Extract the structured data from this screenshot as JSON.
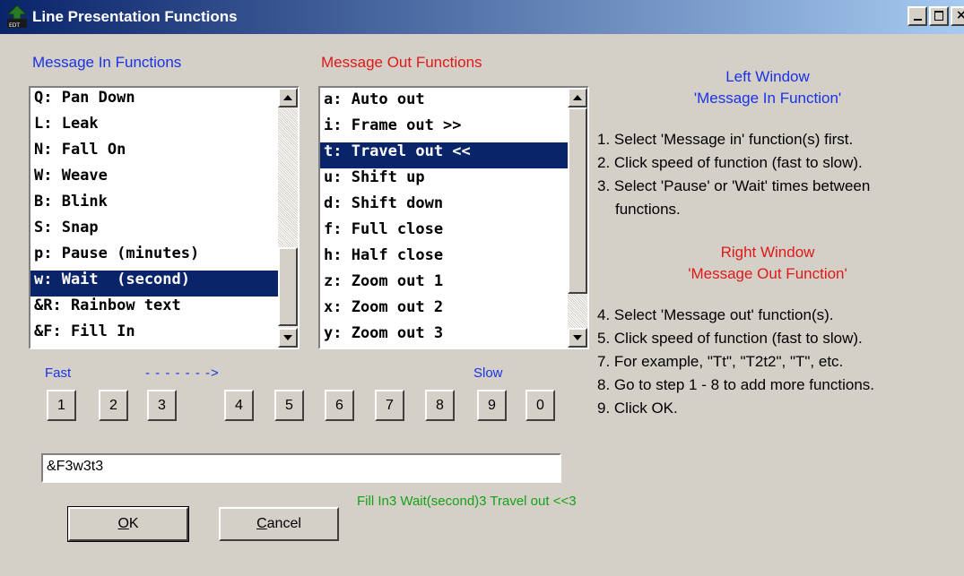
{
  "window": {
    "title": "Line Presentation Functions",
    "close_glyph": "×"
  },
  "lists": {
    "in_header": "Message In Functions",
    "out_header": "Message Out Functions",
    "in_items": [
      "Q: Pan Down",
      "L: Leak",
      "N: Fall On",
      "W: Weave",
      "B: Blink",
      "S: Snap",
      "p: Pause (minutes)",
      "w: Wait  (second)",
      "&R: Rainbow text",
      "&F: Fill In"
    ],
    "in_selected": "w: Wait  (second)",
    "out_items": [
      "a: Auto out",
      "i: Frame out >>",
      "t: Travel out <<",
      "u: Shift up",
      "d: Shift down",
      "f: Full close",
      "h: Half close",
      "z: Zoom out 1",
      "x: Zoom out 2",
      "y: Zoom out 3"
    ],
    "out_selected": "t: Travel out <<"
  },
  "speed": {
    "fast_label": "Fast",
    "arrow_label": "- - - - - - ->",
    "slow_label": "Slow",
    "buttons": [
      "1",
      "2",
      "3",
      "4",
      "5",
      "6",
      "7",
      "8",
      "9",
      "0"
    ]
  },
  "sequence": {
    "value": "&F3w3t3",
    "description": "Fill In3  Wait(second)3  Travel out <<3"
  },
  "buttons": {
    "ok_mnemonic": "O",
    "ok_rest": "K",
    "cancel_mnemonic": "C",
    "cancel_rest": "ancel"
  },
  "help": {
    "left_title": "Left Window",
    "left_subtitle": "'Message In Function'",
    "left_steps": [
      "1. Select 'Message in' function(s) first.",
      "2. Click speed of function (fast to slow).",
      "3. Select 'Pause' or 'Wait' times between",
      "functions."
    ],
    "right_title": "Right Window",
    "right_subtitle": "'Message Out Function'",
    "right_steps": [
      "4. Select 'Message out' function(s).",
      "5. Click speed of function (fast to slow).",
      "7. For example, \"Tt\", \"T2t2\", \"T\", etc.",
      "8. Go to step 1 - 8 to add more functions.",
      "9. Click OK."
    ]
  },
  "colors": {
    "title_bar": "#0a246a",
    "blue_text": "#1a32e8",
    "red_text": "#e01818",
    "green_text": "#16a016",
    "selection": "#0a246a",
    "window_bg": "#d4d0c8"
  },
  "icons": {
    "app": "edt-app-icon",
    "scroll_up": "arrow-up-icon",
    "scroll_down": "arrow-down-icon"
  }
}
